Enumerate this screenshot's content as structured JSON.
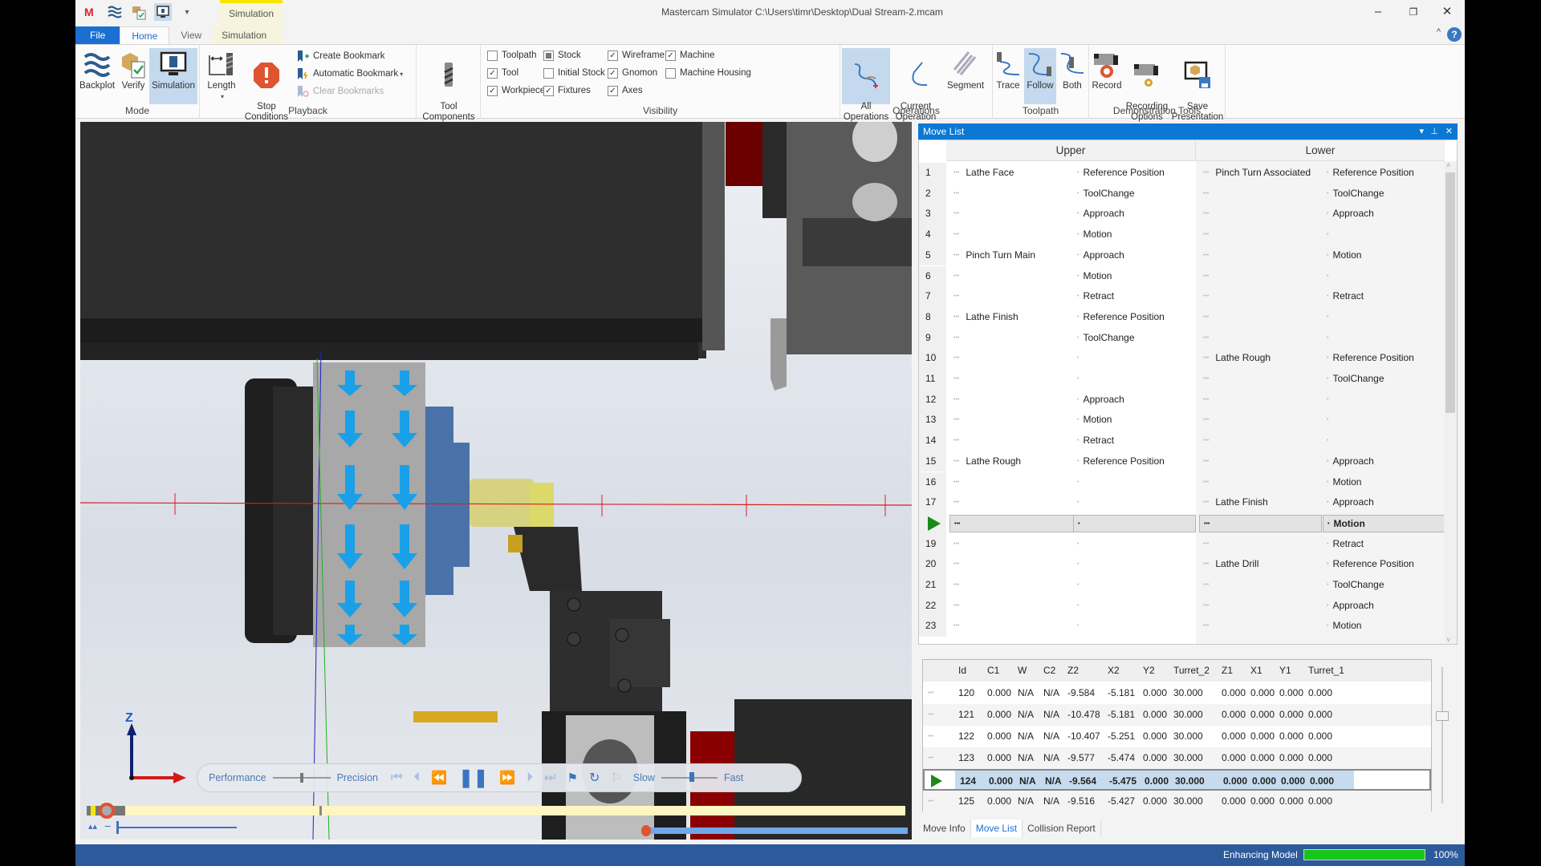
{
  "window": {
    "title": "Mastercam Simulator  C:\\Users\\timr\\Desktop\\Dual Stream-2.mcam",
    "context_tab_label": "Simulation",
    "controls": {
      "minimize": "–",
      "restore": "❐",
      "close": "✕",
      "collapse": "^",
      "help": "?"
    }
  },
  "tabs": [
    {
      "label": "File"
    },
    {
      "label": "Home",
      "active": true
    },
    {
      "label": "View"
    },
    {
      "label": "Simulation"
    }
  ],
  "ribbon": {
    "mode": {
      "label": "Mode",
      "buttons": [
        {
          "label": "Backplot",
          "icon": "backplot-icon"
        },
        {
          "label": "Verify",
          "icon": "verify-icon"
        },
        {
          "label": "Simulation",
          "icon": "simulation-icon",
          "active": true
        }
      ]
    },
    "playback": {
      "label": "Playback",
      "length": "Length",
      "stop_conditions": "Stop\nConditions",
      "create_bookmark": "Create Bookmark",
      "automatic_bookmark": "Automatic Bookmark",
      "clear_bookmarks": "Clear Bookmarks",
      "tool_components": "Tool\nComponents"
    },
    "visibility": {
      "label": "Visibility",
      "items": [
        {
          "label": "Toolpath",
          "state": "unchecked"
        },
        {
          "label": "Tool",
          "state": "checked"
        },
        {
          "label": "Workpiece",
          "state": "checked"
        },
        {
          "label": "Stock",
          "state": "partial"
        },
        {
          "label": "Initial Stock",
          "state": "unchecked"
        },
        {
          "label": "Fixtures",
          "state": "checked"
        },
        {
          "label": "Wireframe",
          "state": "checked"
        },
        {
          "label": "Gnomon",
          "state": "checked"
        },
        {
          "label": "Axes",
          "state": "checked"
        },
        {
          "label": "Machine",
          "state": "checked"
        },
        {
          "label": "Machine Housing",
          "state": "unchecked"
        }
      ]
    },
    "operations": {
      "label": "Operations",
      "buttons": [
        {
          "label": "All\nOperations",
          "active": true
        },
        {
          "label": "Current\nOperation"
        },
        {
          "label": "Segment"
        }
      ]
    },
    "toolpath": {
      "label": "Toolpath",
      "buttons": [
        {
          "label": "Trace"
        },
        {
          "label": "Follow",
          "active": true
        },
        {
          "label": "Both"
        }
      ]
    },
    "demo": {
      "label": "Demonstration Tools",
      "buttons": [
        {
          "label": "Record"
        },
        {
          "label": "Recording\nOptions"
        },
        {
          "label": "Save\nPresentation"
        }
      ]
    }
  },
  "viewport": {
    "playback_bar": {
      "performance": "Performance",
      "precision": "Precision",
      "slow": "Slow",
      "fast": "Fast",
      "quality_slider": 0.5,
      "speed_slider": 0.55
    },
    "gnomon": {
      "z": "Z"
    },
    "timeline_upper_progress": 0.02,
    "timeline_lower_progress": 0.0
  },
  "move_list": {
    "title": "Move List",
    "headers": {
      "upper": "Upper",
      "lower": "Lower"
    },
    "rows": [
      {
        "n": "1",
        "uo": "Lathe Face",
        "um": "Reference Position",
        "lo": "Pinch Turn Associated",
        "lm": "Reference Position"
      },
      {
        "n": "2",
        "uo": "",
        "um": "ToolChange",
        "lo": "",
        "lm": "ToolChange"
      },
      {
        "n": "3",
        "uo": "",
        "um": "Approach",
        "lo": "",
        "lm": "Approach"
      },
      {
        "n": "4",
        "uo": "",
        "um": "Motion",
        "lo": "",
        "lm": ""
      },
      {
        "n": "5",
        "uo": "Pinch Turn Main",
        "um": "Approach",
        "lo": "",
        "lm": "Motion"
      },
      {
        "n": "6",
        "uo": "",
        "um": "Motion",
        "lo": "",
        "lm": ""
      },
      {
        "n": "7",
        "uo": "",
        "um": "Retract",
        "lo": "",
        "lm": "Retract"
      },
      {
        "n": "8",
        "uo": "Lathe Finish",
        "um": "Reference Position",
        "lo": "",
        "lm": ""
      },
      {
        "n": "9",
        "uo": "",
        "um": "ToolChange",
        "lo": "",
        "lm": ""
      },
      {
        "n": "10",
        "uo": "",
        "um": "",
        "lo": "Lathe Rough",
        "lm": "Reference Position"
      },
      {
        "n": "11",
        "uo": "",
        "um": "",
        "lo": "",
        "lm": "ToolChange"
      },
      {
        "n": "12",
        "uo": "",
        "um": "Approach",
        "lo": "",
        "lm": ""
      },
      {
        "n": "13",
        "uo": "",
        "um": "Motion",
        "lo": "",
        "lm": ""
      },
      {
        "n": "14",
        "uo": "",
        "um": "Retract",
        "lo": "",
        "lm": ""
      },
      {
        "n": "15",
        "uo": "Lathe Rough",
        "um": "Reference Position",
        "lo": "",
        "lm": "Approach"
      },
      {
        "n": "16",
        "uo": "",
        "um": "",
        "lo": "",
        "lm": "Motion"
      },
      {
        "n": "17",
        "uo": "",
        "um": "",
        "lo": "Lathe Finish",
        "lm": "Approach"
      },
      {
        "n": "18",
        "uo": "",
        "um": "",
        "lo": "",
        "lm": "Motion",
        "current": true
      },
      {
        "n": "19",
        "uo": "",
        "um": "",
        "lo": "",
        "lm": "Retract"
      },
      {
        "n": "20",
        "uo": "",
        "um": "",
        "lo": "Lathe Drill",
        "lm": "Reference Position"
      },
      {
        "n": "21",
        "uo": "",
        "um": "",
        "lo": "",
        "lm": "ToolChange"
      },
      {
        "n": "22",
        "uo": "",
        "um": "",
        "lo": "",
        "lm": "Approach"
      },
      {
        "n": "23",
        "uo": "",
        "um": "",
        "lo": "",
        "lm": "Motion"
      }
    ]
  },
  "data_table": {
    "columns": [
      "Id",
      "C1",
      "W",
      "C2",
      "Z2",
      "X2",
      "Y2",
      "Turret_2",
      "Z1",
      "X1",
      "Y1",
      "Turret_1"
    ],
    "rows": [
      [
        "120",
        "0.000",
        "N/A",
        "N/A",
        "-9.584",
        "-5.181",
        "0.000",
        "30.000",
        "0.000",
        "0.000",
        "0.000",
        "0.000"
      ],
      [
        "121",
        "0.000",
        "N/A",
        "N/A",
        "-10.478",
        "-5.181",
        "0.000",
        "30.000",
        "0.000",
        "0.000",
        "0.000",
        "0.000"
      ],
      [
        "122",
        "0.000",
        "N/A",
        "N/A",
        "-10.407",
        "-5.251",
        "0.000",
        "30.000",
        "0.000",
        "0.000",
        "0.000",
        "0.000"
      ],
      [
        "123",
        "0.000",
        "N/A",
        "N/A",
        "-9.577",
        "-5.474",
        "0.000",
        "30.000",
        "0.000",
        "0.000",
        "0.000",
        "0.000"
      ],
      [
        "124",
        "0.000",
        "N/A",
        "N/A",
        "-9.564",
        "-5.475",
        "0.000",
        "30.000",
        "0.000",
        "0.000",
        "0.000",
        "0.000"
      ],
      [
        "125",
        "0.000",
        "N/A",
        "N/A",
        "-9.516",
        "-5.427",
        "0.000",
        "30.000",
        "0.000",
        "0.000",
        "0.000",
        "0.000"
      ]
    ],
    "current_row_index": 4
  },
  "panel_tabs": [
    {
      "label": "Move Info"
    },
    {
      "label": "Move List",
      "active": true
    },
    {
      "label": "Collision Report"
    }
  ],
  "status": {
    "label": "Enhancing Model",
    "progress": 1.0,
    "progress_text": "100%",
    "progress_color": "#15c61d"
  },
  "colors": {
    "accent": "#1b6fd1",
    "panel_header": "#0b78d4",
    "status_bar": "#2d5a9a",
    "context_tab": "#f6e600"
  }
}
